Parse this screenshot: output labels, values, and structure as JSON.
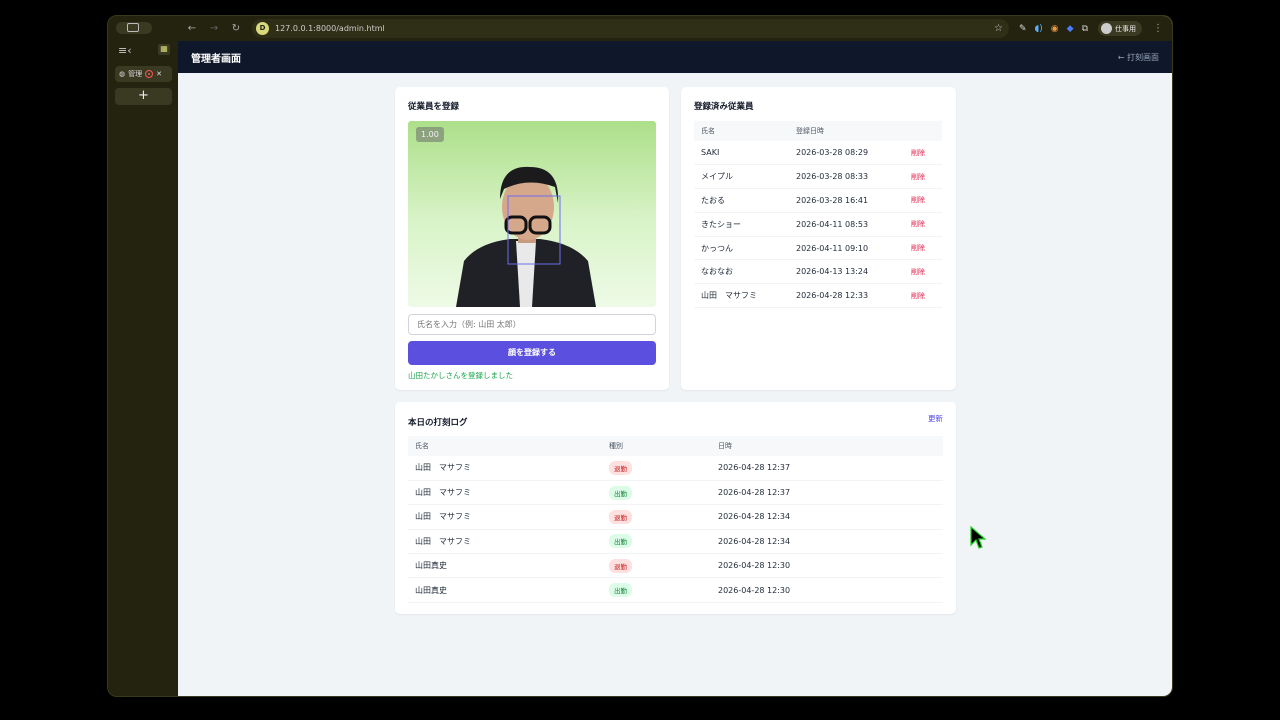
{
  "browser": {
    "url": "127.0.0.1:8000/admin.html",
    "site_letter": "D",
    "profile": "仕事用",
    "tab_label": "管理"
  },
  "header": {
    "title": "管理者画面",
    "back_link": "← 打刻画面"
  },
  "register": {
    "title": "従業員を登録",
    "score": "1.00",
    "name_placeholder": "氏名を入力（例: 山田 太郎）",
    "submit_label": "顔を登録する",
    "message": "山田たかしさんを登録しました"
  },
  "employees": {
    "title": "登録済み従業員",
    "columns": [
      "氏名",
      "登録日時",
      ""
    ],
    "delete_label": "削除",
    "rows": [
      {
        "name": "SAKI",
        "date": "2026-03-28 08:29"
      },
      {
        "name": "メイプル",
        "date": "2026-03-28 08:33"
      },
      {
        "name": "たおる",
        "date": "2026-03-28 16:41"
      },
      {
        "name": "きたショー",
        "date": "2026-04-11 08:53"
      },
      {
        "name": "かっつん",
        "date": "2026-04-11 09:10"
      },
      {
        "name": "なおなお",
        "date": "2026-04-13 13:24"
      },
      {
        "name": "山田　マサフミ",
        "date": "2026-04-28 12:33"
      }
    ]
  },
  "log": {
    "title": "本日の打刻ログ",
    "refresh_label": "更新",
    "columns": [
      "氏名",
      "種別",
      "日時"
    ],
    "rows": [
      {
        "name": "山田　マサフミ",
        "type": "退勤",
        "kind": "out",
        "time": "2026-04-28 12:37"
      },
      {
        "name": "山田　マサフミ",
        "type": "出勤",
        "kind": "in",
        "time": "2026-04-28 12:37"
      },
      {
        "name": "山田　マサフミ",
        "type": "退勤",
        "kind": "out",
        "time": "2026-04-28 12:34"
      },
      {
        "name": "山田　マサフミ",
        "type": "出勤",
        "kind": "in",
        "time": "2026-04-28 12:34"
      },
      {
        "name": "山田真史",
        "type": "退勤",
        "kind": "out",
        "time": "2026-04-28 12:30"
      },
      {
        "name": "山田真史",
        "type": "出勤",
        "kind": "in",
        "time": "2026-04-28 12:30"
      }
    ]
  },
  "colors": {
    "primary": "#5b4fe0",
    "header_bg": "#0f172a",
    "success": "#16a34a",
    "danger": "#e11d48"
  }
}
